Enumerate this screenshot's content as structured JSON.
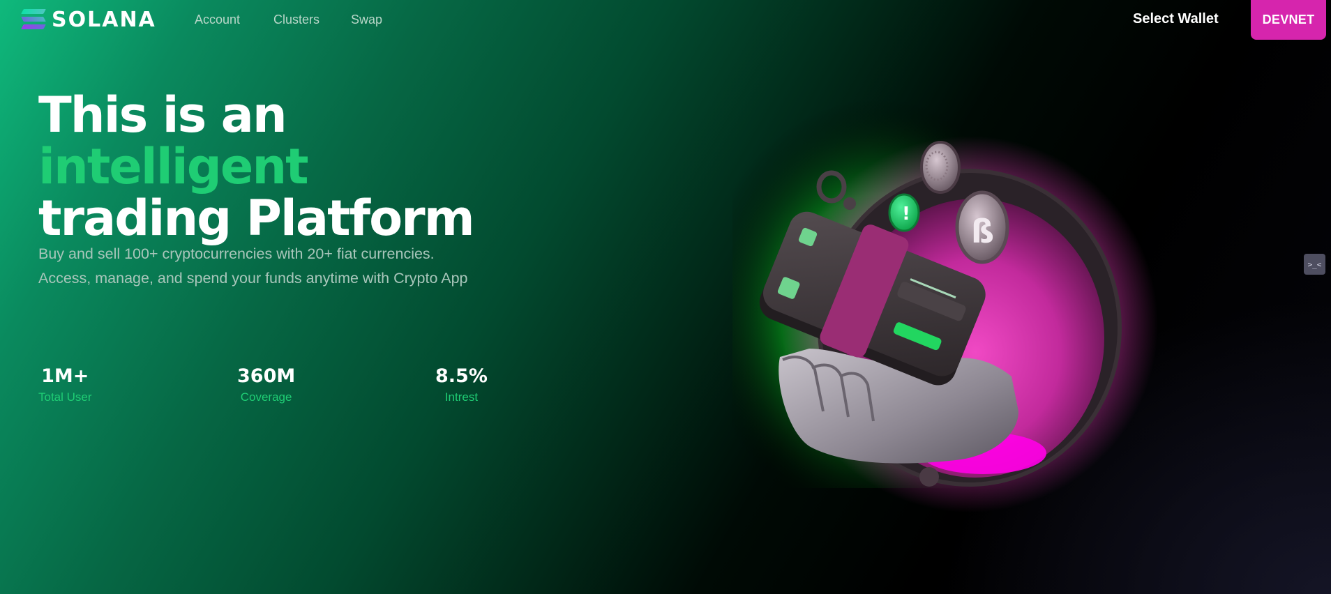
{
  "nav": {
    "logo_text": "SOLANA",
    "links": [
      "Account",
      "Clusters",
      "Swap"
    ],
    "select_wallet": "Select Wallet",
    "network_button": "DEVNET"
  },
  "hero": {
    "title_line1_start": "This is an ",
    "title_line1_accent": "intelligent",
    "title_line2": "trading Platform",
    "description": "Buy and sell 100+ cryptocurrencies with 20+ fiat currencies. Access, manage, and spend your funds anytime with Crypto App"
  },
  "stats": [
    {
      "value": "1M+",
      "label": "Total User"
    },
    {
      "value": "360M",
      "label": "Coverage"
    },
    {
      "value": "8.5%",
      "label": "Intrest"
    }
  ],
  "side_widget": ">_<",
  "colors": {
    "accent_green": "#1fcd74",
    "devnet_magenta": "#d625ad",
    "portal_pink": "#e43ab8"
  },
  "icons": [
    "solana-logo-icon",
    "wallet-hand-illustration",
    "coin-icon",
    "dev-tools-icon"
  ]
}
